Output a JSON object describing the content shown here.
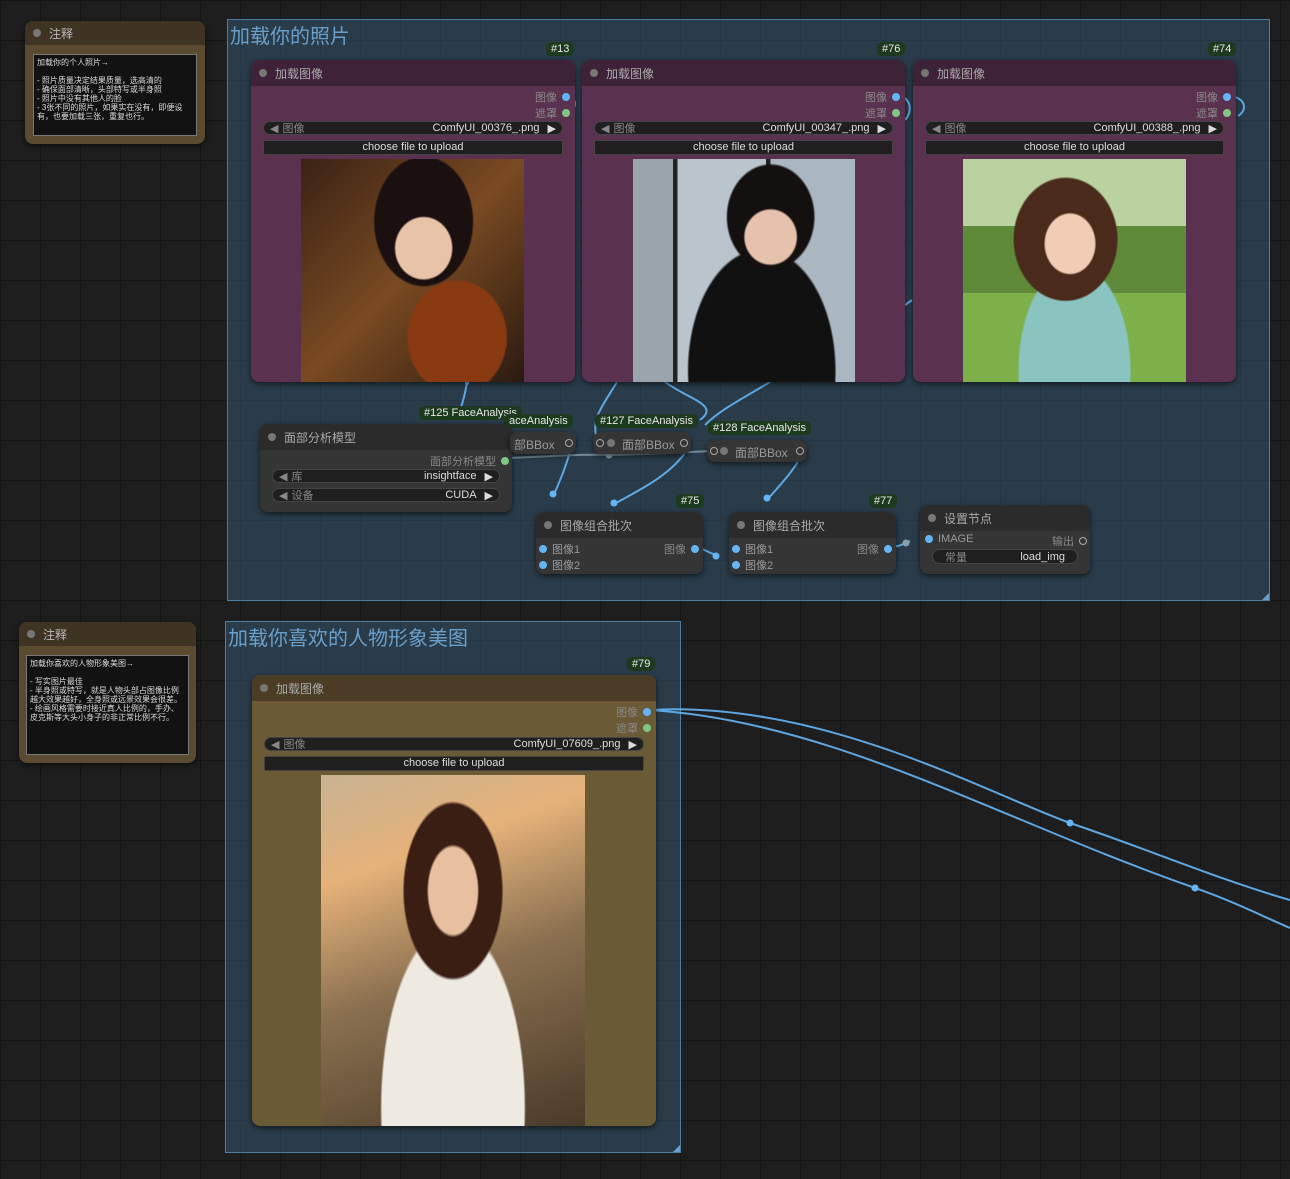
{
  "groups": {
    "g1_title": "加载你的照片",
    "g2_title": "加载你喜欢的人物形象美图"
  },
  "notes": {
    "n1": {
      "title": "注释",
      "text": "加载你的个人照片→\n\n- 照片质量决定结果质量，选高清的\n- 确保面部清晰，头部特写或半身照\n- 照片中没有其他人的脸\n- 3张不同的照片，如果实在没有，即便设有，也要加载三张，重复也行。"
    },
    "n2": {
      "title": "注释",
      "text": "加载你喜欢的人物形象美图→\n\n- 写实图片最佳\n- 半身照或特写，就是人物头部占图像比例越大效果越好，全身照或远景效果会很差。\n- 绘画风格需要时接近真人比例的，手办、皮克斯等大头小身子的非正常比例不行。"
    }
  },
  "load_nodes": [
    {
      "id": "#13",
      "title": "加载图像",
      "out_image": "图像",
      "out_mask": "遮罩",
      "combo_label": "图像",
      "file": "ComfyUI_00376_.png",
      "upload": "choose file to upload"
    },
    {
      "id": "#76",
      "title": "加载图像",
      "out_image": "图像",
      "out_mask": "遮罩",
      "combo_label": "图像",
      "file": "ComfyUI_00347_.png",
      "upload": "choose file to upload"
    },
    {
      "id": "#74",
      "title": "加载图像",
      "out_image": "图像",
      "out_mask": "遮罩",
      "combo_label": "图像",
      "file": "ComfyUI_00388_.png",
      "upload": "choose file to upload"
    },
    {
      "id": "#79",
      "title": "加载图像",
      "out_image": "图像",
      "out_mask": "遮罩",
      "combo_label": "图像",
      "file": "ComfyUI_07609_.png",
      "upload": "choose file to upload"
    }
  ],
  "face_model_node": {
    "title": "面部分析模型",
    "output": "面部分析模型",
    "lib_label": "库",
    "lib_value": "insightface",
    "device_label": "设备",
    "device_value": "CUDA"
  },
  "face_badges": {
    "b125": "#125 FaceAnalysis",
    "b_hidden": "aceAnalysis",
    "b127": "#127 FaceAnalysis",
    "b128": "#128 FaceAnalysis"
  },
  "bbox_nodes": {
    "partial": "部BBox",
    "n127": "面部BBox",
    "n128": "面部BBox"
  },
  "batch_nodes": [
    {
      "id": "#75",
      "title": "图像组合批次",
      "in1": "图像1",
      "in2": "图像2",
      "out": "图像"
    },
    {
      "id": "#77",
      "title": "图像组合批次",
      "in1": "图像1",
      "in2": "图像2",
      "out": "图像"
    }
  ],
  "set_node": {
    "title": "设置节点",
    "in": "IMAGE",
    "out": "输出",
    "const_label": "常量",
    "const_value": "load_img"
  },
  "colors": {
    "purple_node": "#5a3250",
    "purple_head": "#3e2238",
    "gold_node": "#6b5a36",
    "gold_head": "#4a3c25",
    "wire_blue": "#64b5f6"
  }
}
